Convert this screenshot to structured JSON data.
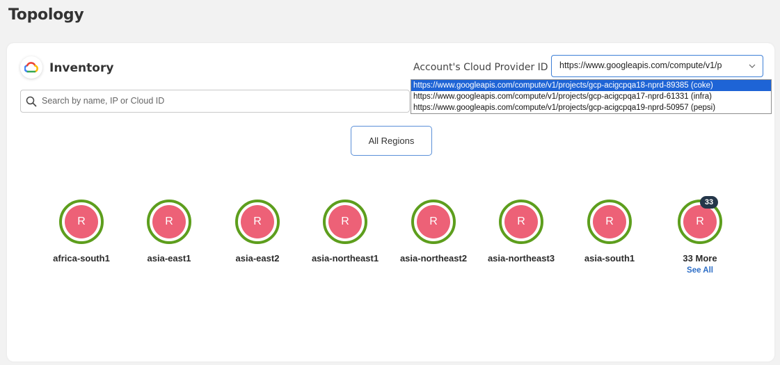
{
  "page": {
    "title": "Topology"
  },
  "inventory": {
    "title": "Inventory",
    "account_label": "Account's Cloud Provider ID",
    "account_selected": "https://www.googleapis.com/compute/v1/p",
    "search_placeholder": "Search by name, IP or Cloud ID",
    "options": [
      "https://www.googleapis.com/compute/v1/projects/gcp-acigcpqa18-nprd-89385 (coke)",
      "https://www.googleapis.com/compute/v1/projects/gcp-acigcpqa17-nprd-61331 (infra)",
      "https://www.googleapis.com/compute/v1/projects/gcp-acigcpqa19-nprd-50957 (pepsi)"
    ],
    "region_button": "All Regions"
  },
  "regions": [
    {
      "letter": "R",
      "name": "africa-south1"
    },
    {
      "letter": "R",
      "name": "asia-east1"
    },
    {
      "letter": "R",
      "name": "asia-east2"
    },
    {
      "letter": "R",
      "name": "asia-northeast1"
    },
    {
      "letter": "R",
      "name": "asia-northeast2"
    },
    {
      "letter": "R",
      "name": "asia-northeast3"
    },
    {
      "letter": "R",
      "name": "asia-south1"
    }
  ],
  "more": {
    "letter": "R",
    "badge": "33",
    "label": "33 More",
    "link": "See All"
  },
  "colors": {
    "ring": "#5d9e1d",
    "node_fill": "#ed6177",
    "accent": "#3d7fd6",
    "selected_option": "#1e64d6",
    "badge": "#243649"
  },
  "icons": {
    "logo": "google-cloud-icon",
    "search": "search-icon",
    "chevron": "chevron-down-icon"
  }
}
